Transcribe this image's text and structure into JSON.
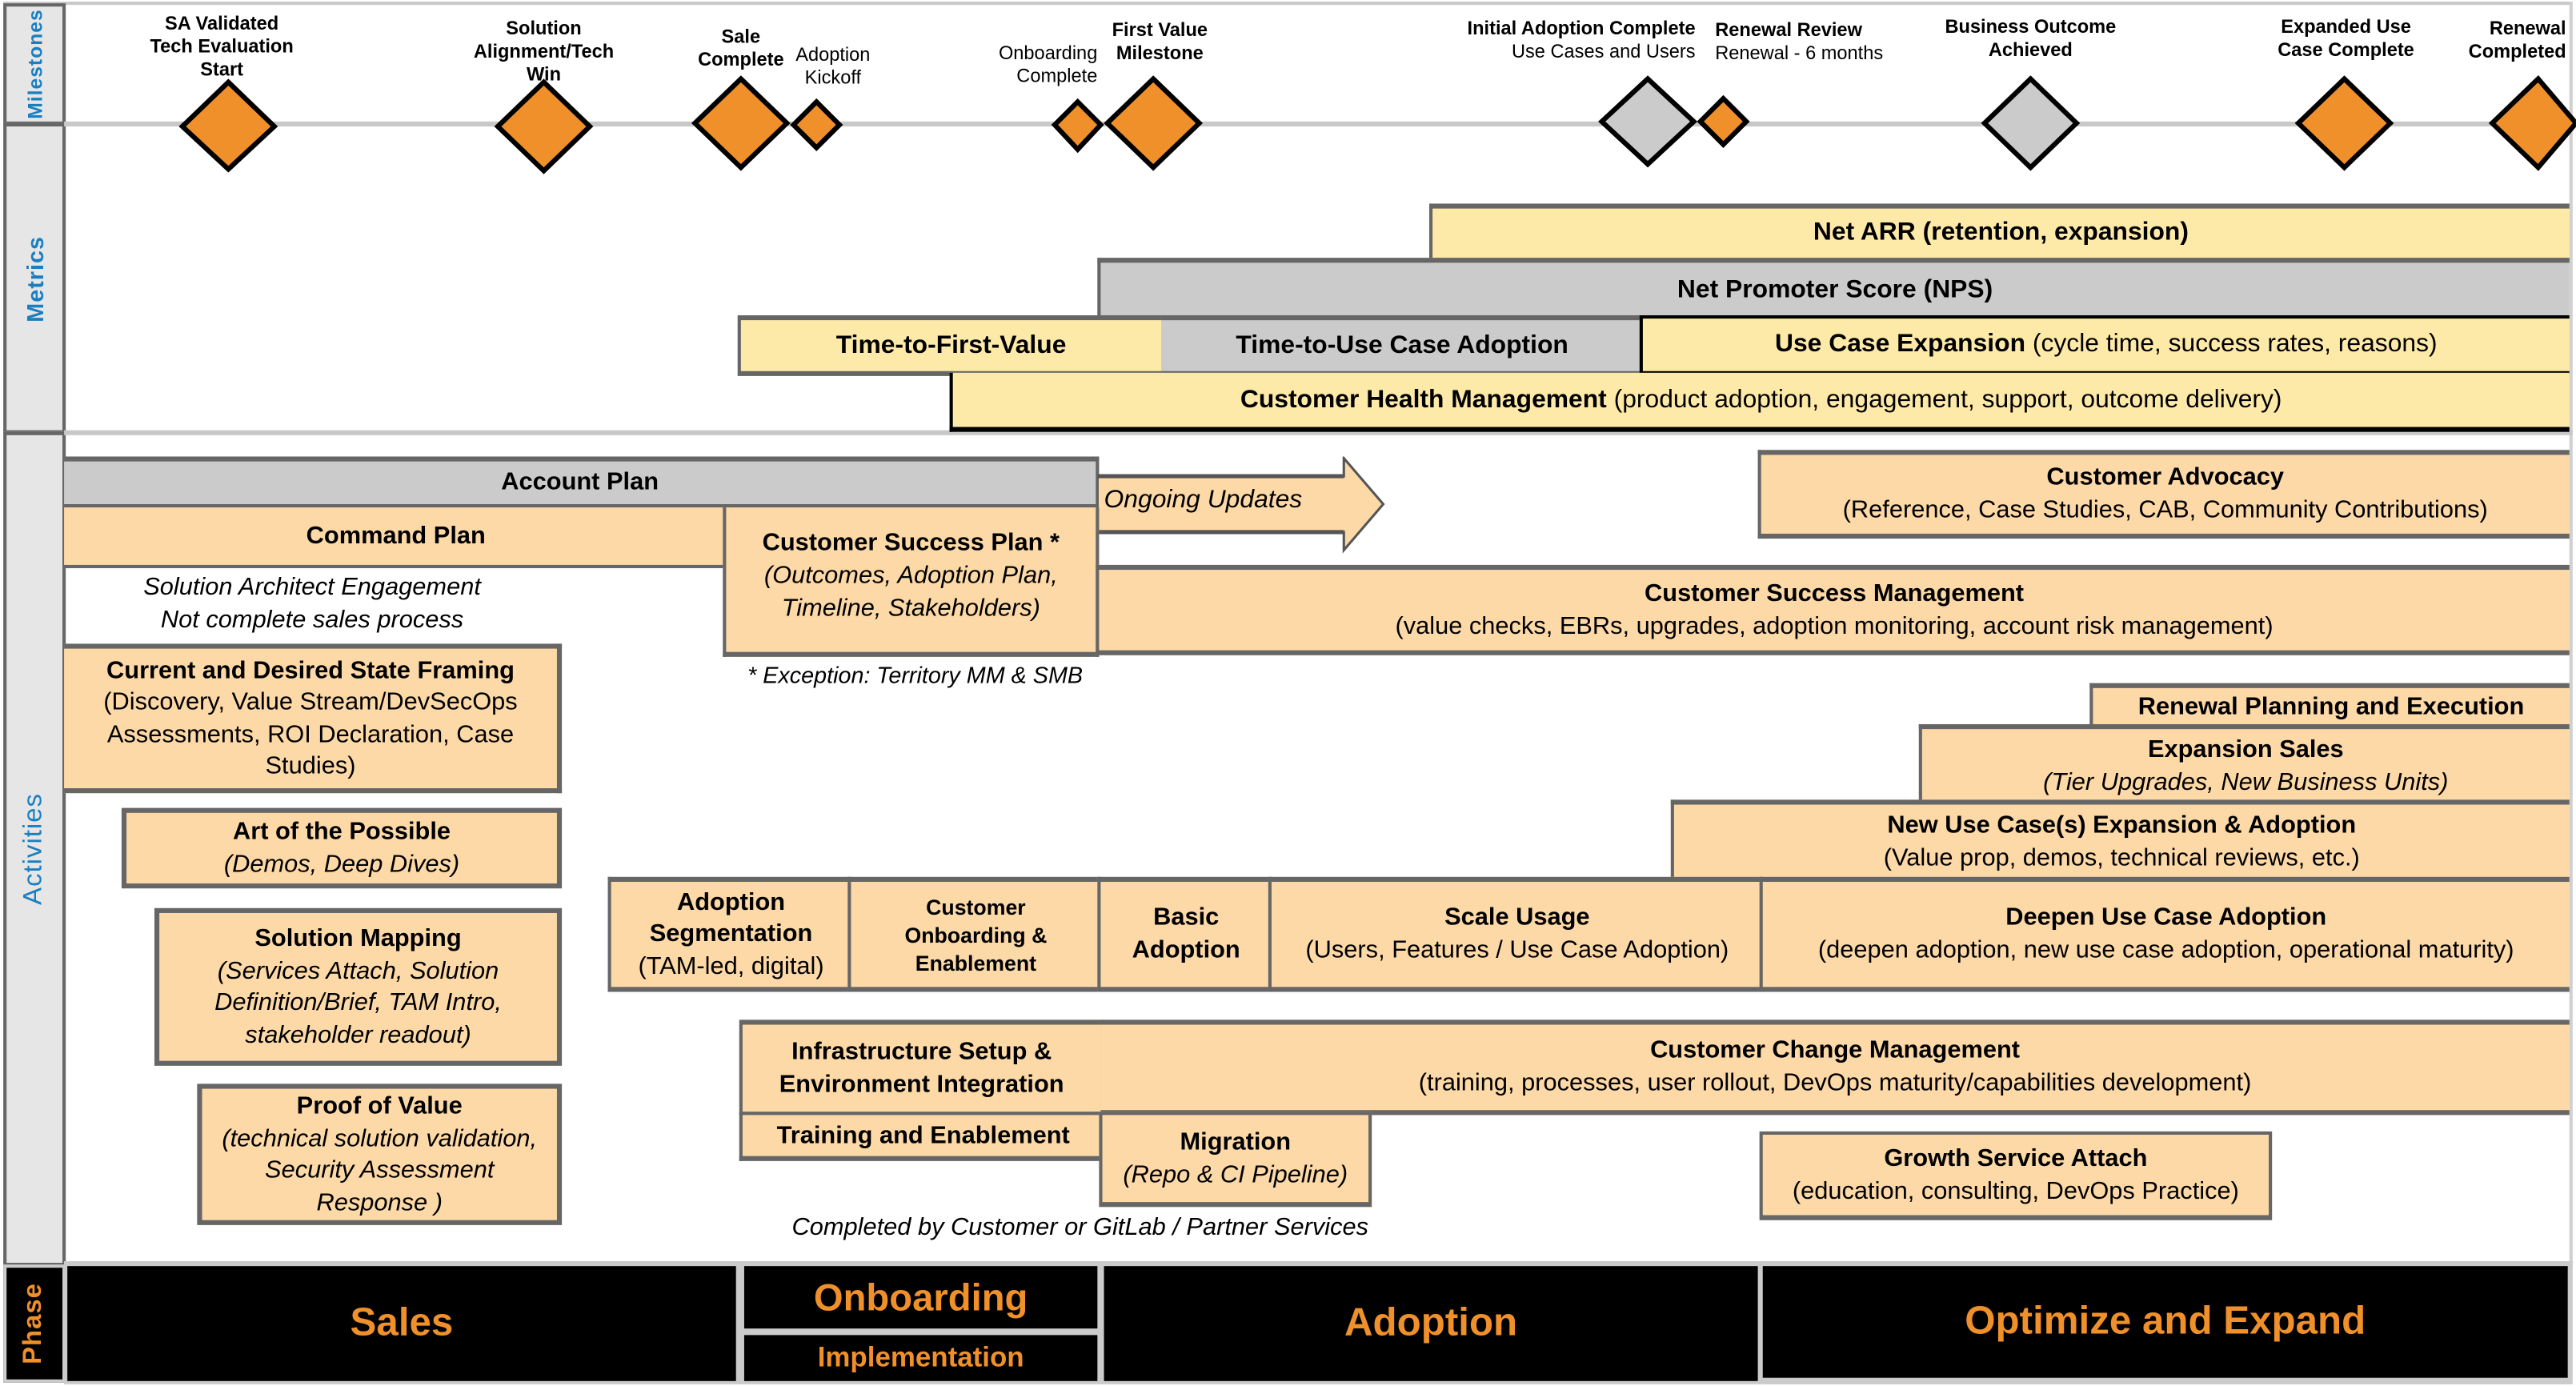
{
  "row_labels": {
    "milestones": "Milestones",
    "metrics": "Metrics",
    "activities": "Activities",
    "phase": "Phase"
  },
  "colors": {
    "milestone_orange": "#f0902a",
    "milestone_gray": "#cbcbcb",
    "activity_fill": "#fdd9a8",
    "metric_fill": "#feeaa8",
    "metric_gray": "#cbcbcb",
    "label_blue": "#1a7fc1",
    "phase_text": "#f0902a"
  },
  "milestones": [
    {
      "lines": [
        "SA Validated",
        "Tech Evaluation",
        "Start"
      ],
      "bold": true,
      "color": "orange",
      "size": "large"
    },
    {
      "lines": [
        "Solution",
        "Alignment/Tech",
        "Win"
      ],
      "bold": true,
      "color": "orange",
      "size": "large"
    },
    {
      "lines": [
        "Sale",
        "Complete"
      ],
      "bold": true,
      "color": "orange",
      "size": "large"
    },
    {
      "lines": [
        "Adoption",
        "Kickoff"
      ],
      "bold": false,
      "color": "orange",
      "size": "small"
    },
    {
      "lines": [
        "Onboarding",
        "Complete"
      ],
      "bold": false,
      "color": "orange",
      "size": "small"
    },
    {
      "lines": [
        "First Value",
        "Milestone"
      ],
      "bold": true,
      "color": "orange",
      "size": "large"
    },
    {
      "title": "Initial Adoption Complete",
      "subtitle": "Use Cases and Users",
      "color": "gray",
      "size": "large"
    },
    {
      "title": "Renewal Review",
      "subtitle": "Renewal - 6 months",
      "color": "orange",
      "size": "small"
    },
    {
      "lines": [
        "Business Outcome",
        "Achieved"
      ],
      "bold": true,
      "color": "gray",
      "size": "large"
    },
    {
      "lines": [
        "Expanded Use",
        "Case Complete"
      ],
      "bold": true,
      "color": "orange",
      "size": "large"
    },
    {
      "lines": [
        "Renewal",
        "Completed"
      ],
      "bold": true,
      "color": "orange",
      "size": "large"
    }
  ],
  "metrics": {
    "net_arr": {
      "title": "Net ARR (retention, expansion)"
    },
    "nps": {
      "title": "Net Promoter Score (NPS)"
    },
    "ttfv": {
      "title": "Time-to-First-Value"
    },
    "ttuca": {
      "title": "Time-to-Use Case Adoption"
    },
    "use_case_expansion": {
      "title": "Use Case Expansion",
      "detail": " (cycle time, success rates, reasons)"
    },
    "customer_health": {
      "title": "Customer Health Management",
      "detail": " (product adoption, engagement, support, outcome delivery)"
    }
  },
  "activities": {
    "account_plan": {
      "title": "Account Plan"
    },
    "ongoing_updates": {
      "title": "Ongoing Updates"
    },
    "command_plan": {
      "title": "Command Plan"
    },
    "customer_success_plan": {
      "title": "Customer Success Plan *",
      "detail": "(Outcomes, Adoption Plan, Timeline, Stakeholders)"
    },
    "sa_engagement_note": {
      "line1": "Solution Architect Engagement",
      "line2": "Not complete sales process"
    },
    "exception_note": "* Exception: Territory MM & SMB",
    "customer_advocacy": {
      "title": "Customer Advocacy",
      "detail": "(Reference, Case Studies, CAB, Community Contributions)"
    },
    "customer_success_management": {
      "title": "Customer Success Management",
      "detail": "(value checks, EBRs, upgrades, adoption monitoring, account risk management)"
    },
    "current_desired_state": {
      "title": "Current and Desired State Framing",
      "detail": "(Discovery, Value Stream/DevSecOps Assessments, ROI Declaration, Case Studies)"
    },
    "art_of_possible": {
      "title": "Art of the Possible",
      "detail": "(Demos, Deep Dives)"
    },
    "solution_mapping": {
      "title": "Solution Mapping",
      "detail": "(Services Attach, Solution Definition/Brief, TAM Intro, stakeholder readout)"
    },
    "proof_of_value": {
      "title": "Proof of Value",
      "detail": "(technical solution validation, Security Assessment Response )"
    },
    "renewal_planning": {
      "title": "Renewal Planning and Execution"
    },
    "expansion_sales": {
      "title": "Expansion Sales",
      "detail": "(Tier Upgrades, New Business Units)"
    },
    "new_use_case": {
      "title": "New Use Case(s) Expansion & Adoption",
      "detail": "(Value prop, demos, technical reviews, etc.)"
    },
    "adoption_segmentation": {
      "title": "Adoption Segmentation",
      "detail": "(TAM-led, digital)"
    },
    "customer_onboarding": {
      "title": "Customer Onboarding & Enablement"
    },
    "basic_adoption": {
      "title": "Basic Adoption"
    },
    "scale_usage": {
      "title": "Scale Usage",
      "detail": "(Users, Features / Use Case Adoption)"
    },
    "deepen_use_case": {
      "title": "Deepen Use Case Adoption",
      "detail": "(deepen adoption, new use case adoption, operational maturity)"
    },
    "infrastructure_setup": {
      "title": "Infrastructure Setup & Environment Integration"
    },
    "training_enablement": {
      "title": "Training and Enablement"
    },
    "customer_change_mgmt": {
      "title": "Customer Change Management",
      "detail": "(training, processes, user rollout, DevOps maturity/capabilities development)"
    },
    "migration": {
      "title": "Migration",
      "detail": "(Repo & CI Pipeline)"
    },
    "growth_service_attach": {
      "title": "Growth Service Attach",
      "detail": "(education, consulting, DevOps Practice)"
    },
    "services_note": "Completed by Customer or GitLab / Partner Services"
  },
  "phases": {
    "sales": "Sales",
    "onboarding": "Onboarding",
    "implementation": "Implementation",
    "adoption": "Adoption",
    "optimize_expand": "Optimize and Expand"
  }
}
